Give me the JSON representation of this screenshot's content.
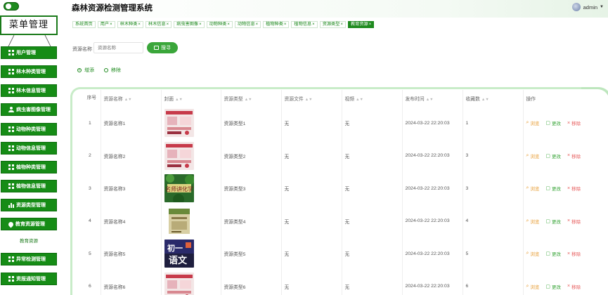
{
  "app": {
    "title": "森林资源检测管理系统"
  },
  "user": {
    "name": "admin"
  },
  "sidebar": {
    "menu_title": "菜单管理",
    "items": [
      {
        "label": "用户管理",
        "icon": "grid-icon"
      },
      {
        "label": "林木种类管理",
        "icon": "grid-icon"
      },
      {
        "label": "林木信息管理",
        "icon": "grid-icon"
      },
      {
        "label": "病虫害图像管理",
        "icon": "user-icon"
      },
      {
        "label": "动物种类管理",
        "icon": "grid-icon"
      },
      {
        "label": "动物信息管理",
        "icon": "grid-icon"
      },
      {
        "label": "植物种类管理",
        "icon": "grid-icon"
      },
      {
        "label": "植物信息管理",
        "icon": "grid-icon"
      },
      {
        "label": "资源类型管理",
        "icon": "bar-chart-icon"
      },
      {
        "label": "教育资源管理",
        "icon": "pin-icon"
      },
      {
        "label": "异常检测管理",
        "icon": "grid-icon"
      },
      {
        "label": "资报通知管理",
        "icon": "grid-icon"
      }
    ],
    "sub_item": "教育资源"
  },
  "tabs": [
    {
      "label": "系统首页",
      "closable": false
    },
    {
      "label": "用户",
      "closable": true
    },
    {
      "label": "林木种类",
      "closable": true
    },
    {
      "label": "林木信息",
      "closable": true
    },
    {
      "label": "病虫害图像",
      "closable": true
    },
    {
      "label": "动物种类",
      "closable": true
    },
    {
      "label": "动物信息",
      "closable": true
    },
    {
      "label": "植物种类",
      "closable": true
    },
    {
      "label": "植物信息",
      "closable": true
    },
    {
      "label": "资源类型",
      "closable": true
    },
    {
      "label": "教育资源",
      "closable": true,
      "active": true
    }
  ],
  "search": {
    "label": "资源名称",
    "placeholder": "资源名称",
    "button": "搜寻"
  },
  "actions": {
    "add": "增添",
    "delete": "移除"
  },
  "table": {
    "columns": [
      "序号",
      "资源名称",
      "封面",
      "资源类型",
      "资源文件",
      "视频",
      "发布时间",
      "收藏数",
      "操作"
    ],
    "rows": [
      {
        "seq": "1",
        "name": "资源名称1",
        "cover": "pink",
        "type": "资源类型1",
        "file": "无",
        "video": "无",
        "time": "2024-03-22 22:20:03",
        "fav": "1"
      },
      {
        "seq": "2",
        "name": "资源名称2",
        "cover": "pink",
        "type": "资源类型2",
        "file": "无",
        "video": "无",
        "time": "2024-03-22 22:20:03",
        "fav": "3"
      },
      {
        "seq": "3",
        "name": "资源名称3",
        "cover": "green",
        "type": "资源类型3",
        "file": "无",
        "video": "无",
        "time": "2024-03-22 22:20:03",
        "fav": "3"
      },
      {
        "seq": "4",
        "name": "资源名称4",
        "cover": "tan",
        "type": "资源类型4",
        "file": "无",
        "video": "无",
        "time": "2024-03-22 22:20:03",
        "fav": "4"
      },
      {
        "seq": "5",
        "name": "资源名称5",
        "cover": "dark",
        "type": "资源类型5",
        "file": "无",
        "video": "无",
        "time": "2024-03-22 22:20:03",
        "fav": "5"
      },
      {
        "seq": "6",
        "name": "资源名称6",
        "cover": "pink",
        "type": "资源类型6",
        "file": "无",
        "video": "无",
        "time": "2024-03-22 22:20:03",
        "fav": "6"
      }
    ],
    "ops": {
      "view": "浏览",
      "edit": "更改",
      "delete": "移除"
    }
  },
  "colors": {
    "primary": "#1e8a1e",
    "button": "#3aa63a",
    "view": "#e69a2e",
    "delete": "#e65a5a"
  }
}
